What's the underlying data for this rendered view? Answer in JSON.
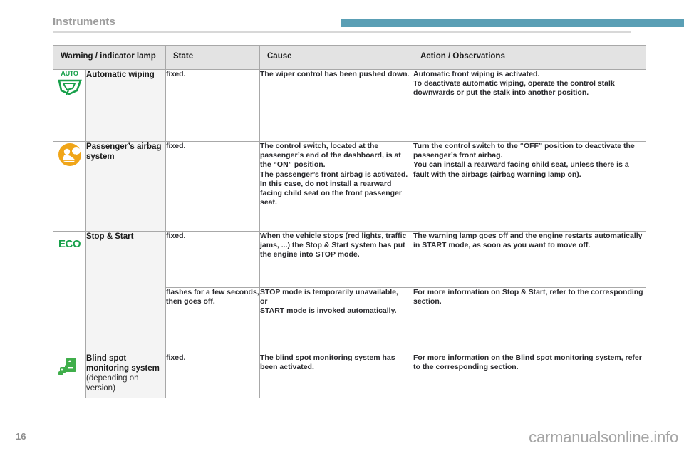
{
  "header": {
    "chapter_title": "Instruments",
    "accent_color": "#5a9fb5"
  },
  "table": {
    "columns": [
      {
        "key": "lamp",
        "label": "Warning / indicator lamp"
      },
      {
        "key": "state",
        "label": "State"
      },
      {
        "key": "cause",
        "label": "Cause"
      },
      {
        "key": "action",
        "label": "Action / Observations"
      }
    ],
    "rows": [
      {
        "icon": {
          "name": "auto-wiping-icon",
          "glyph_text": "AUTO",
          "color": "#17a04a"
        },
        "name": "Automatic wiping",
        "name_note": "",
        "state": "fixed.",
        "cause": "The wiper control has been pushed down.",
        "action_lines": [
          "Automatic front wiping is activated.",
          "To deactivate automatic wiping, operate the control stalk downwards or put the stalk into another position."
        ]
      },
      {
        "icon": {
          "name": "passenger-airbag-icon",
          "glyph_text": "",
          "color": "#f0a518"
        },
        "name": "Passenger’s airbag system",
        "name_note": "",
        "state": "fixed.",
        "cause_lines": [
          "The control switch, located at the passenger’s end of the dashboard, is at the “ON” position.",
          "The passenger’s front airbag is activated. In this case, do not install a rearward facing child seat on the front passenger seat."
        ],
        "action_lines": [
          "Turn the control switch to the “OFF” position to deactivate the passenger’s front airbag.",
          "You can install a rearward facing child seat, unless there is a fault with the airbags (airbag warning lamp on)."
        ]
      },
      {
        "icon": {
          "name": "eco-stop-start-icon",
          "glyph_text": "ECO",
          "color": "#17a04a"
        },
        "name": "Stop & Start",
        "name_note": "",
        "state": "fixed.",
        "cause": "When the vehicle stops (red lights, traffic jams, ...) the Stop & Start system has put the engine into STOP mode.",
        "action_lines": [
          "The warning lamp goes off and the engine restarts automatically in START mode, as soon as you want to move off."
        ]
      },
      {
        "state": "flashes for a few seconds, then goes off.",
        "cause_lines": [
          "STOP mode is temporarily unavailable,",
          "or",
          "START mode is invoked automatically."
        ],
        "action_lines": [
          "For more information on Stop & Start, refer to the corresponding section."
        ]
      },
      {
        "icon": {
          "name": "blind-spot-monitoring-icon",
          "glyph_text": "",
          "color": "#3fae4a"
        },
        "name": "Blind spot monitoring system",
        "name_note": "(depending on version)",
        "state": "fixed.",
        "cause": "The blind spot monitoring system has been activated.",
        "action_lines": [
          "For more information on the Blind spot monitoring system, refer to the corresponding section."
        ]
      }
    ]
  },
  "footer": {
    "page_number": "16",
    "watermark": "carmanualsonline.info"
  }
}
